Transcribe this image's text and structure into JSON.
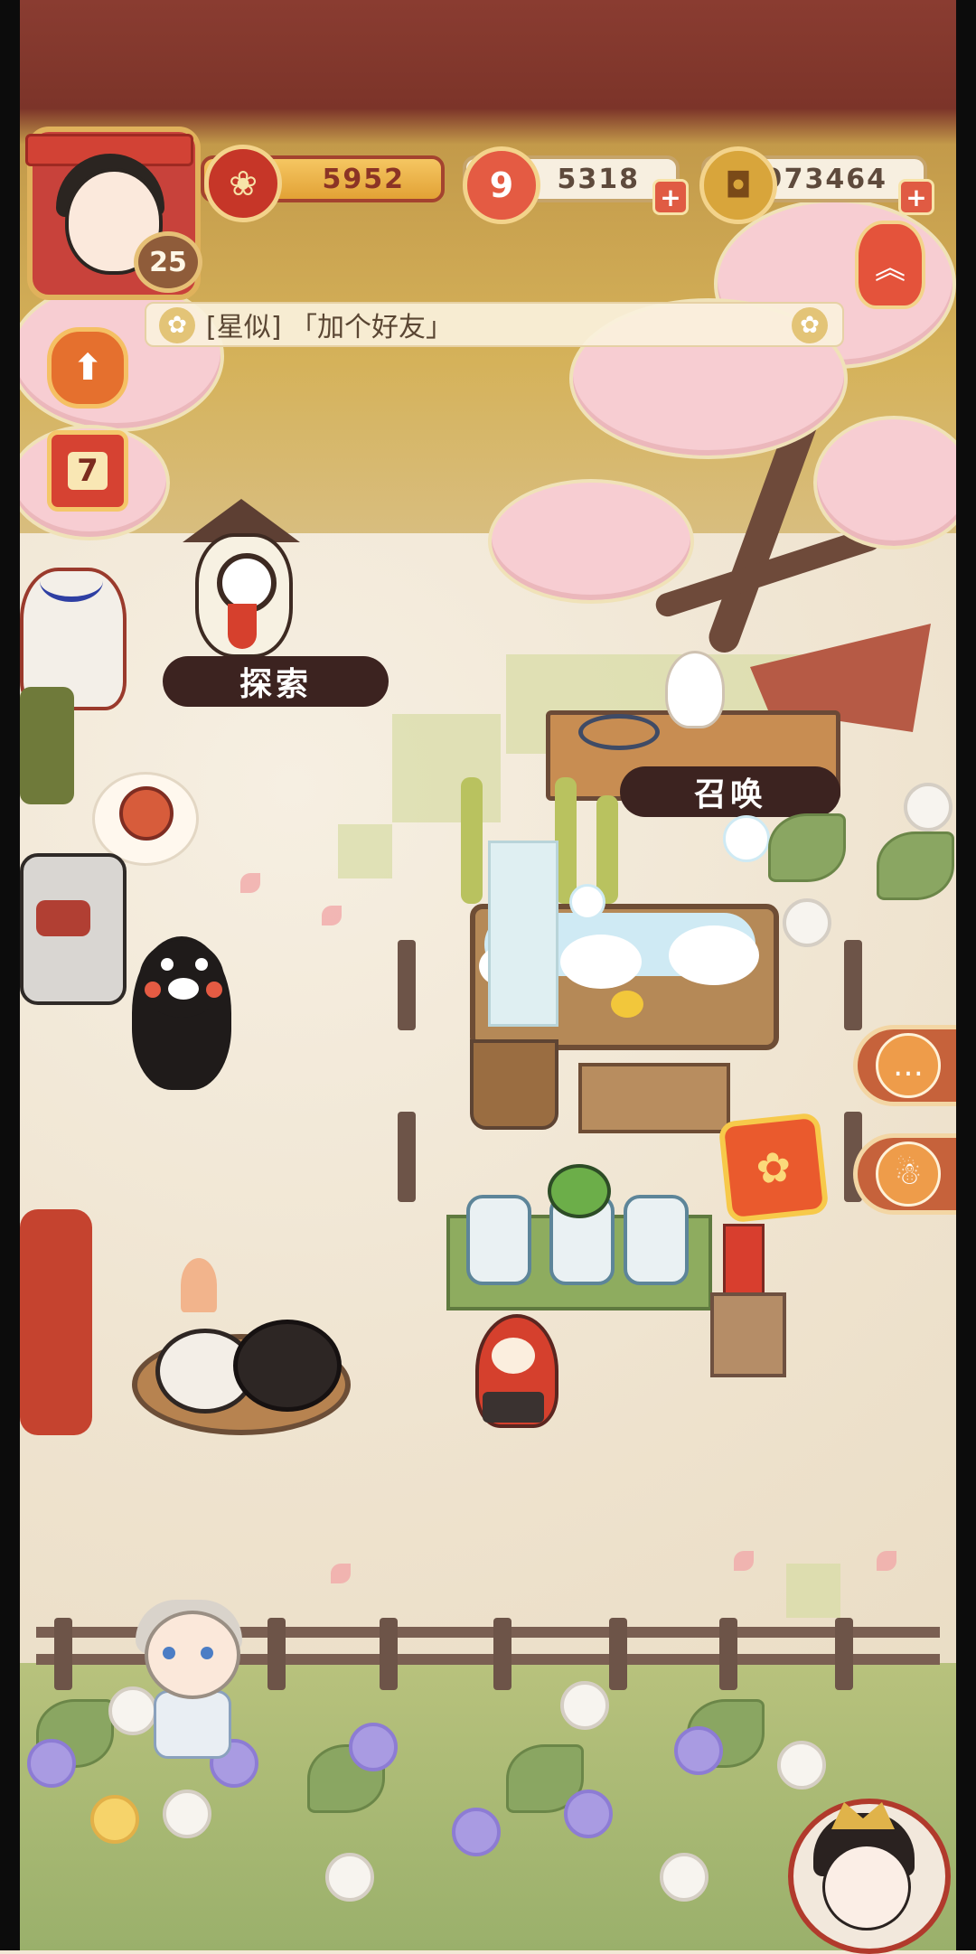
{
  "player": {
    "level": "25",
    "avatar_icon": "shrine-maiden-avatar-icon"
  },
  "resources": {
    "plum_currency": {
      "icon": "plum-blossom-icon",
      "value": "5952"
    },
    "magatama": {
      "icon": "magatama-icon",
      "value": "5318",
      "add_label": "+"
    },
    "coins": {
      "icon": "gold-coin-icon",
      "value": "973464",
      "add_label": "+"
    }
  },
  "message_bar": {
    "text": "[星似] 「加个好友」"
  },
  "left_buttons": {
    "upgrade": {
      "icon": "up-arrow-lantern-icon",
      "glyph": "⬆"
    },
    "calendar": {
      "icon": "calendar-icon",
      "day": "7"
    }
  },
  "map": {
    "explore_label": "探索",
    "summon_label": "召唤"
  },
  "right_tabs": {
    "chat": {
      "icon": "chat-bubble-icon",
      "glyph": "…"
    },
    "summon": {
      "icon": "summon-doll-icon",
      "glyph": "☃"
    }
  },
  "colors": {
    "accent_red": "#c63628",
    "label_bg": "#3c2320",
    "gold": "#e2a235",
    "sakura": "#f7cdd2"
  }
}
